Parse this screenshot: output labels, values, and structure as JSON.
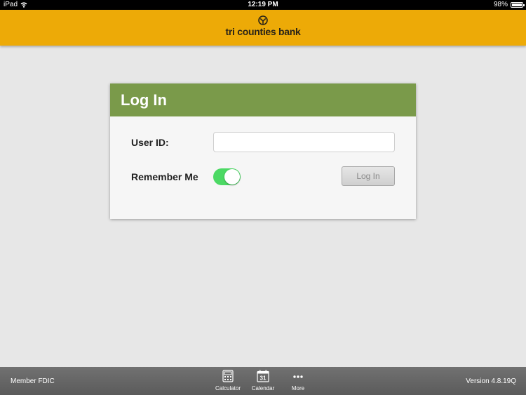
{
  "status_bar": {
    "device": "iPad",
    "time": "12:19 PM",
    "battery_text": "98%",
    "battery_level": 0.98
  },
  "header": {
    "logo_text": "tri counties bank",
    "brand_color": "#edaa07"
  },
  "login": {
    "title": "Log In",
    "header_color": "#7a9a4a",
    "user_id_label": "User ID:",
    "user_id_value": "",
    "user_id_placeholder": "",
    "remember_label": "Remember Me",
    "remember_on": true,
    "button_label": "Log In"
  },
  "footer": {
    "left_text": "Member FDIC",
    "right_text": "Version 4.8.19Q",
    "tabs": [
      {
        "label": "Calculator",
        "icon": "calculator-icon"
      },
      {
        "label": "Calendar",
        "icon": "calendar-icon",
        "icon_text": "31"
      },
      {
        "label": "More",
        "icon": "more-icon"
      }
    ]
  }
}
